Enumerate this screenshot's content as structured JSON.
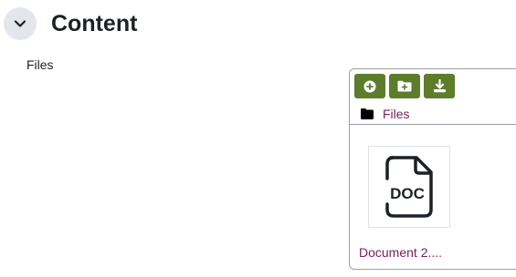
{
  "section": {
    "title": "Content",
    "toggle_icon": "chevron-down-icon"
  },
  "field": {
    "label": "Files"
  },
  "file_manager": {
    "toolbar": [
      {
        "name": "add-file-button",
        "icon": "plus-circle-icon"
      },
      {
        "name": "create-folder-button",
        "icon": "folder-plus-icon"
      },
      {
        "name": "download-button",
        "icon": "download-icon"
      }
    ],
    "path": {
      "icon": "folder-icon",
      "label": "Files"
    },
    "files": [
      {
        "name": "Document 2....",
        "icon": "doc-file-icon",
        "icon_text": "DOC"
      }
    ]
  },
  "colors": {
    "accent_green": "#5d7d2a",
    "link": "#7a1f5b",
    "toggle_bg": "#e3e6eb"
  }
}
